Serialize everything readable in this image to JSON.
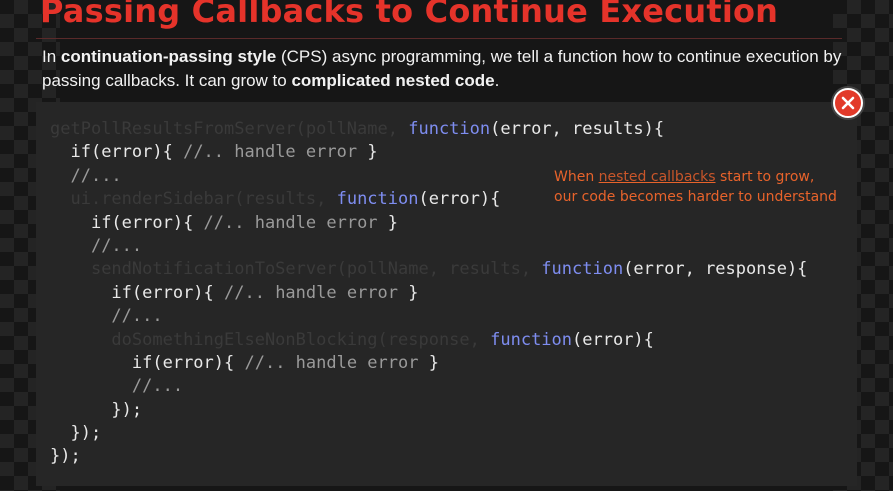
{
  "slide": {
    "title": "Passing Callbacks to Continue Execution",
    "intro": {
      "p1": "In ",
      "b1": "continuation-passing style",
      "p2": " (CPS) async programming, we tell a function how to continue execution by passing callbacks. It can grow to ",
      "b2": "complicated nested code",
      "p3": "."
    }
  },
  "code": {
    "l1": {
      "dim": "getPollResultsFromServer(pollName, ",
      "kw": "function",
      "rest": "(error, results){"
    },
    "l2": {
      "indent": "  ",
      "code": "if(error){ ",
      "comment": "//.. handle error",
      "end": " }"
    },
    "l3": {
      "indent": "  ",
      "comment": "//..."
    },
    "l4": {
      "indent": "  ",
      "dim": "ui.renderSidebar(results, ",
      "kw": "function",
      "rest": "(error){"
    },
    "l5": {
      "indent": "    ",
      "code": "if(error){ ",
      "comment": "//.. handle error",
      "end": " }"
    },
    "l6": {
      "indent": "    ",
      "comment": "//..."
    },
    "l7": {
      "indent": "    ",
      "dim": "sendNotificationToServer(pollName, results, ",
      "kw": "function",
      "rest": "(error, response){"
    },
    "l8": {
      "indent": "      ",
      "code": "if(error){ ",
      "comment": "//.. handle error",
      "end": " }"
    },
    "l9": {
      "indent": "      ",
      "comment": "//..."
    },
    "l10": {
      "indent": "      ",
      "dim": "doSomethingElseNonBlocking(response, ",
      "kw": "function",
      "rest": "(error){"
    },
    "l11": {
      "indent": "        ",
      "code": "if(error){ ",
      "comment": "//.. handle error",
      "end": " }"
    },
    "l12": {
      "indent": "        ",
      "comment": "//..."
    },
    "l13": {
      "indent": "      ",
      "code": "});"
    },
    "l14": {
      "indent": "  ",
      "code": "});"
    },
    "l15": {
      "indent": "",
      "code": "});"
    }
  },
  "annotation": {
    "line1_pre": "When ",
    "line1_ul": "nested callbacks",
    "line1_post": " start to grow,",
    "line2": "our code becomes harder to understand"
  },
  "icons": {
    "close": "close-icon"
  },
  "colors": {
    "title": "#e5332a",
    "keyword": "#7e8df0",
    "annotation": "#e8632b",
    "close_button": "#e23a2a"
  }
}
